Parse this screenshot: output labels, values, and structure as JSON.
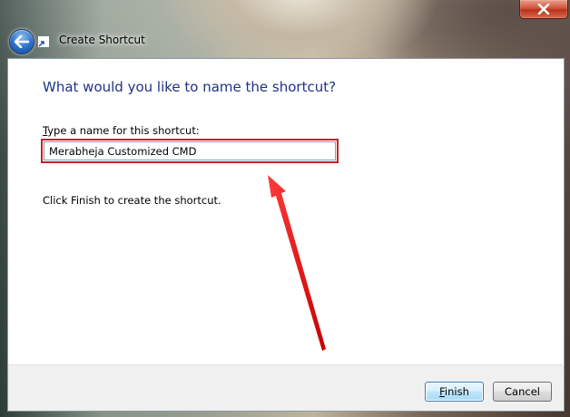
{
  "window": {
    "title": "Create Shortcut"
  },
  "wizard": {
    "heading": "What would you like to name the shortcut?",
    "field_label_underlined": "T",
    "field_label_rest": "ype a name for this shortcut:",
    "name_value": "Merabheja Customized CMD",
    "info_text": "Click Finish to create the shortcut."
  },
  "footer": {
    "finish_underlined": "F",
    "finish_rest": "inish",
    "cancel_label": "Cancel"
  },
  "icons": {
    "back": "back-arrow-icon",
    "app": "shortcut-icon",
    "close": "close-icon",
    "annotation": "red-arrow-annotation"
  },
  "colors": {
    "heading": "#1e3287",
    "highlight": "#c8202a",
    "close_button": "#c8432a"
  }
}
